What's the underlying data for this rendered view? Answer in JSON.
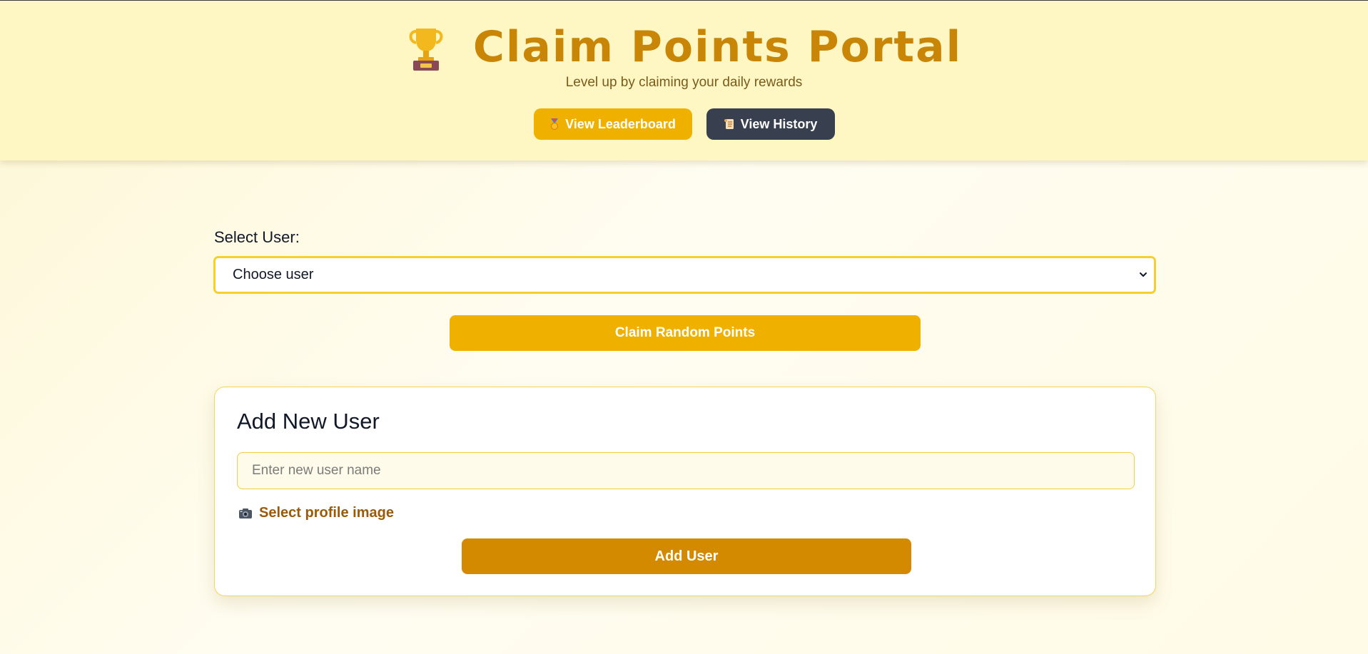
{
  "header": {
    "trophy_icon": "trophy-icon",
    "title": "Claim Points Portal",
    "subtitle": "Level up by claiming your daily rewards",
    "nav": {
      "leaderboard_label": "View Leaderboard",
      "leaderboard_icon": "medal-icon",
      "history_label": "View History",
      "history_icon": "scroll-icon"
    }
  },
  "claim": {
    "select_label": "Select User:",
    "selected_value": "Choose user",
    "button_label": "Claim Random Points"
  },
  "add_user": {
    "title": "Add New User",
    "name_placeholder": "Enter new user name",
    "name_value": "",
    "file_label": "Select profile image",
    "file_icon": "camera-icon",
    "button_label": "Add User"
  },
  "colors": {
    "title": "#c98606",
    "primary_button": "#f0b000",
    "dark_button": "#384050",
    "add_button": "#d38a00",
    "select_border": "#f5cf2a",
    "header_bg": "#fef7c3"
  }
}
